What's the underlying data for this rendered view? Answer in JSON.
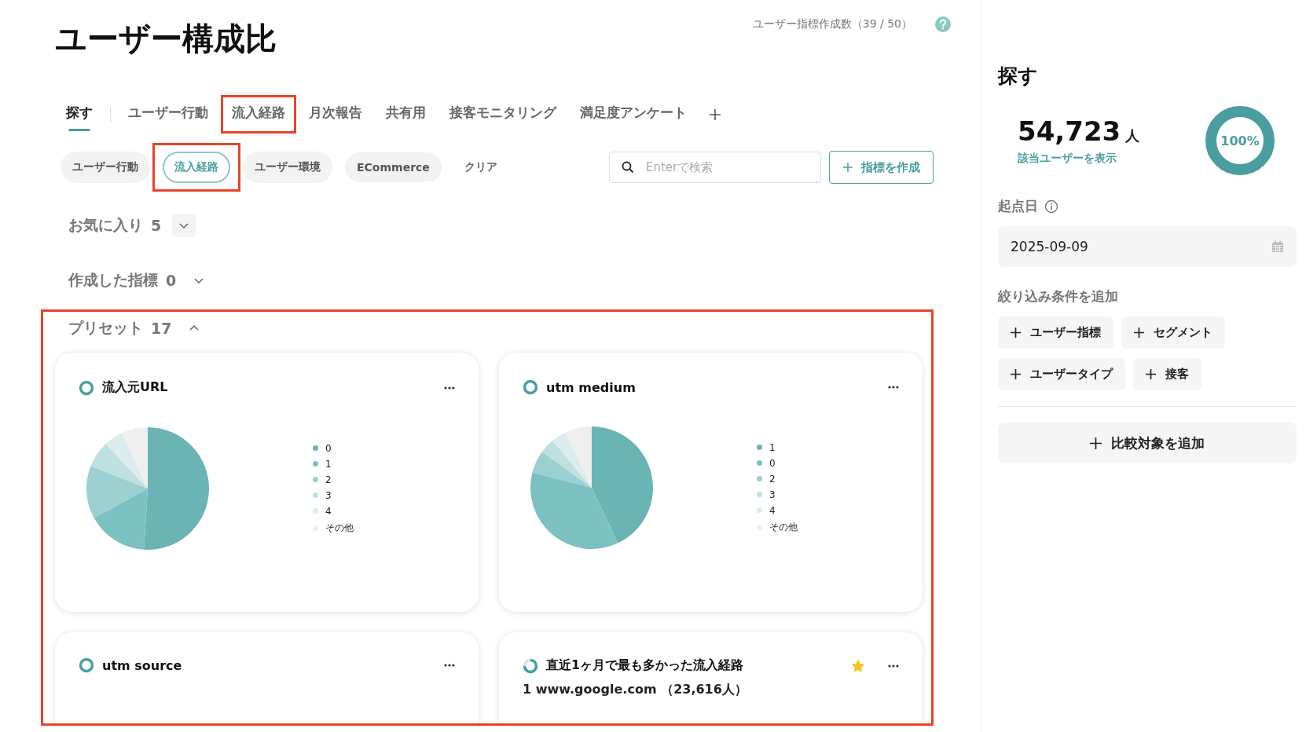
{
  "header": {
    "title": "ユーザー構成比",
    "quota": "ユーザー指標作成数（39 / 50）"
  },
  "tabs": [
    {
      "label": "探す",
      "selected": true,
      "highlighted": false
    },
    {
      "label": "ユーザー行動",
      "selected": false,
      "highlighted": false
    },
    {
      "label": "流入経路",
      "selected": false,
      "highlighted": true
    },
    {
      "label": "月次報告",
      "selected": false,
      "highlighted": false
    },
    {
      "label": "共有用",
      "selected": false,
      "highlighted": false
    },
    {
      "label": "接客モニタリング",
      "selected": false,
      "highlighted": false
    },
    {
      "label": "満足度アンケート",
      "selected": false,
      "highlighted": false
    }
  ],
  "chips": [
    {
      "label": "ユーザー行動",
      "selected": false,
      "highlighted": false
    },
    {
      "label": "流入経路",
      "selected": true,
      "highlighted": true
    },
    {
      "label": "ユーザー環境",
      "selected": false,
      "highlighted": false
    },
    {
      "label": "ECommerce",
      "selected": false,
      "highlighted": false
    }
  ],
  "clear_link": "クリア",
  "search": {
    "placeholder": "Enterで検索"
  },
  "create_button": "指標を作成",
  "sections": [
    {
      "label": "お気に入り",
      "count": "5",
      "expanded": false
    },
    {
      "label": "作成した指標",
      "count": "0",
      "expanded": false
    }
  ],
  "preset": {
    "label": "プリセット",
    "count": "17",
    "expanded": true,
    "highlighted": true,
    "cards": [
      {
        "title": "流入元URL",
        "kind": "pie",
        "starred": false,
        "legend": [
          {
            "label": "0",
            "color": "#6ab4b5"
          },
          {
            "label": "1",
            "color": "#7cc1c2"
          },
          {
            "label": "2",
            "color": "#9ccfcf"
          },
          {
            "label": "3",
            "color": "#bfe0e1"
          },
          {
            "label": "4",
            "color": "#dcedef"
          },
          {
            "label": "その他",
            "color": "#efefef"
          }
        ]
      },
      {
        "title": "utm medium",
        "kind": "pie",
        "starred": false,
        "legend": [
          {
            "label": "1",
            "color": "#6ab4b5"
          },
          {
            "label": "0",
            "color": "#7cc1c2"
          },
          {
            "label": "2",
            "color": "#9ccfcf"
          },
          {
            "label": "3",
            "color": "#bfe0e1"
          },
          {
            "label": "4",
            "color": "#dcedef"
          },
          {
            "label": "その他",
            "color": "#efefef"
          }
        ]
      },
      {
        "title": "utm source",
        "kind": "pie",
        "starred": false
      },
      {
        "title": "直近1ヶ月で最も多かった流入経路",
        "kind": "list",
        "starred": true,
        "rows": [
          "1 www.google.com （23,616人）"
        ]
      }
    ]
  },
  "sidebar": {
    "title": "探す",
    "count": "54,723",
    "unit": "人",
    "link": "該当ユーザーを表示",
    "ring": {
      "label": "100%",
      "level": 1
    },
    "start_date": {
      "label": "起点日",
      "value": "2025-09-09"
    },
    "filter_heading": "絞り込み条件を追加",
    "filter_buttons": [
      "ユーザー指標",
      "セグメント",
      "ユーザータイプ",
      "接客"
    ],
    "compare_button": "比較対象を追加"
  }
}
